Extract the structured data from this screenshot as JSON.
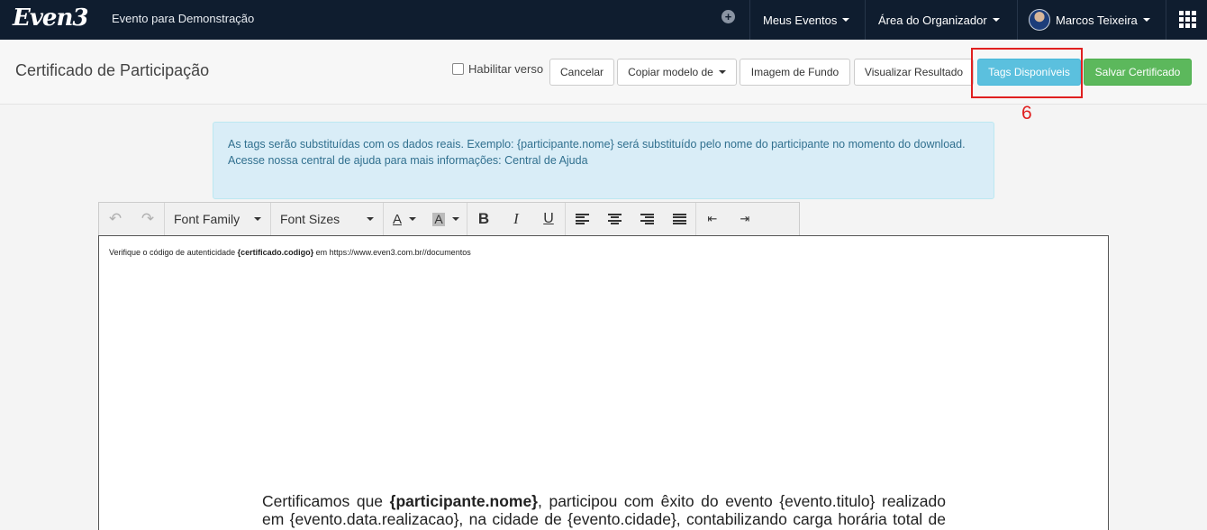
{
  "navbar": {
    "logo": "Even3",
    "event_name": "Evento para Demonstração",
    "menu": [
      "Meus Eventos",
      "Área do Organizador"
    ],
    "user_name": "Marcos Teixeira"
  },
  "header": {
    "title": "Certificado de Participação",
    "enable_version_label": "Habilitar verso",
    "buttons": {
      "cancel": "Cancelar",
      "copy_model": "Copiar modelo de",
      "background": "Imagem de Fundo",
      "preview": "Visualizar Resultado",
      "tags": "Tags Disponíveis",
      "save": "Salvar Certificado"
    }
  },
  "annotation": "6",
  "alert": {
    "line1": "As tags serão substituídas com os dados reais. Exemplo: {participante.nome} será substituído pelo nome do participante no momento do download.",
    "line2_prefix": "Acesse nossa central de ajuda para mais informações: ",
    "help_link": "Central de Ajuda"
  },
  "toolbar": {
    "font_family": "Font Family",
    "font_sizes": "Font Sizes",
    "text_color_letter": "A",
    "bg_color_letter": "A",
    "bold": "B",
    "italic": "I",
    "underline": "U"
  },
  "editor": {
    "verify_prefix": "Verifique o código de autenticidade ",
    "verify_tag": "{certificado.codigo}",
    "verify_suffix": " em https://www.even3.com.br//documentos",
    "body_prefix": "Certificamos que ",
    "body_tag": "{participante.nome}",
    "body_text": ", participou com êxito do evento {evento.titulo} realizado em {evento.data.realizacao}, na cidade de {evento.cidade}, contabilizando carga horária total de {participante.carga}."
  }
}
